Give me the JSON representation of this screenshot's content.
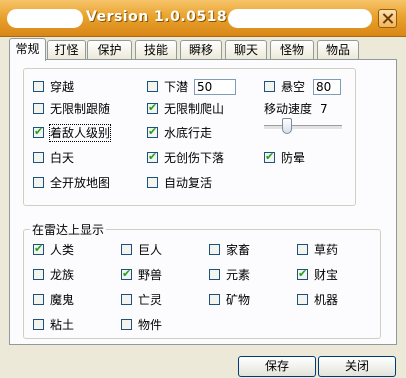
{
  "window": {
    "title": "Version 1.0.0518"
  },
  "tabs": [
    {
      "label": "常规",
      "active": true
    },
    {
      "label": "打怪"
    },
    {
      "label": "保护"
    },
    {
      "label": "技能"
    },
    {
      "label": "瞬移"
    },
    {
      "label": "聊天"
    },
    {
      "label": "怪物"
    },
    {
      "label": "物品"
    }
  ],
  "general": {
    "options": [
      {
        "label": "穿越",
        "checked": false
      },
      {
        "label": "无限制跟随",
        "checked": false
      },
      {
        "label": "着敌人级别",
        "checked": true
      },
      {
        "label": "白天",
        "checked": false
      },
      {
        "label": "全开放地图",
        "checked": false
      },
      {
        "label": "下潜",
        "checked": false
      },
      {
        "label": "无限制爬山",
        "checked": true
      },
      {
        "label": "水底行走",
        "checked": true
      },
      {
        "label": "无创伤下落",
        "checked": true
      },
      {
        "label": "自动复活",
        "checked": false
      },
      {
        "label": "悬空",
        "checked": false
      },
      {
        "label": "防晕",
        "checked": true
      }
    ],
    "dive_value": "50",
    "hover_value": "80",
    "move_speed_label": "移动速度",
    "move_speed_value": "7",
    "move_speed_level": 7
  },
  "radar": {
    "title": "在雷达上显示",
    "items": [
      {
        "label": "人类",
        "checked": true
      },
      {
        "label": "巨人",
        "checked": false
      },
      {
        "label": "家畜",
        "checked": false
      },
      {
        "label": "草药",
        "checked": false
      },
      {
        "label": "龙族",
        "checked": false
      },
      {
        "label": "野兽",
        "checked": true
      },
      {
        "label": "元素",
        "checked": false
      },
      {
        "label": "财宝",
        "checked": true
      },
      {
        "label": "魔鬼",
        "checked": false
      },
      {
        "label": "亡灵",
        "checked": false
      },
      {
        "label": "矿物",
        "checked": false
      },
      {
        "label": "机器",
        "checked": false
      },
      {
        "label": "粘土",
        "checked": false
      },
      {
        "label": "物件",
        "checked": false
      }
    ]
  },
  "buttons": {
    "save": "保存",
    "close": "关闭"
  },
  "icons": {
    "close": "close-icon",
    "check": "checkmark-icon"
  }
}
